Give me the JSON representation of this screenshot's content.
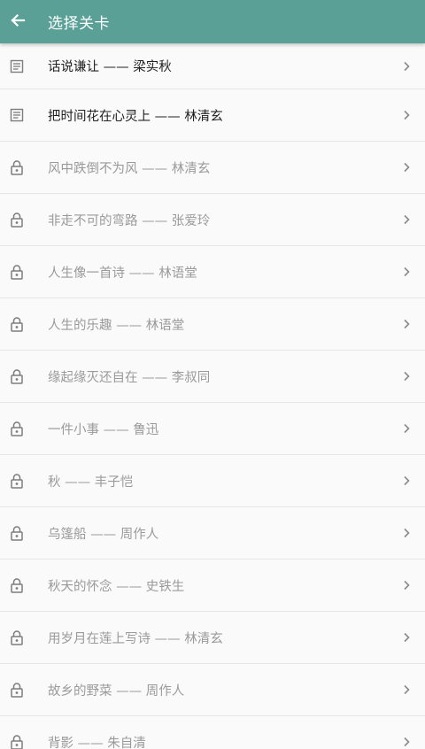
{
  "appbar": {
    "back_icon": "arrow-left-icon",
    "title": "选择关卡",
    "color": "#5aa096"
  },
  "levels": [
    {
      "label": "话说谦让 —— 梁实秋",
      "status": "unlocked",
      "icon": "document-icon"
    },
    {
      "label": "把时间花在心灵上 —— 林清玄",
      "status": "unlocked",
      "icon": "document-icon"
    },
    {
      "label": "风中跌倒不为风 —— 林清玄",
      "status": "locked",
      "icon": "lock-icon"
    },
    {
      "label": "非走不可的弯路 —— 张爱玲",
      "status": "locked",
      "icon": "lock-icon"
    },
    {
      "label": "人生像一首诗 —— 林语堂",
      "status": "locked",
      "icon": "lock-icon"
    },
    {
      "label": "人生的乐趣 —— 林语堂",
      "status": "locked",
      "icon": "lock-icon"
    },
    {
      "label": "缘起缘灭还自在 —— 李叔同",
      "status": "locked",
      "icon": "lock-icon"
    },
    {
      "label": "一件小事 —— 鲁迅",
      "status": "locked",
      "icon": "lock-icon"
    },
    {
      "label": "秋 —— 丰子恺",
      "status": "locked",
      "icon": "lock-icon"
    },
    {
      "label": "乌篷船 —— 周作人",
      "status": "locked",
      "icon": "lock-icon"
    },
    {
      "label": "秋天的怀念 —— 史铁生",
      "status": "locked",
      "icon": "lock-icon"
    },
    {
      "label": "用岁月在莲上写诗 —— 林清玄",
      "status": "locked",
      "icon": "lock-icon"
    },
    {
      "label": "故乡的野菜 —— 周作人",
      "status": "locked",
      "icon": "lock-icon"
    },
    {
      "label": "背影 —— 朱自清",
      "status": "locked",
      "icon": "lock-icon"
    }
  ]
}
